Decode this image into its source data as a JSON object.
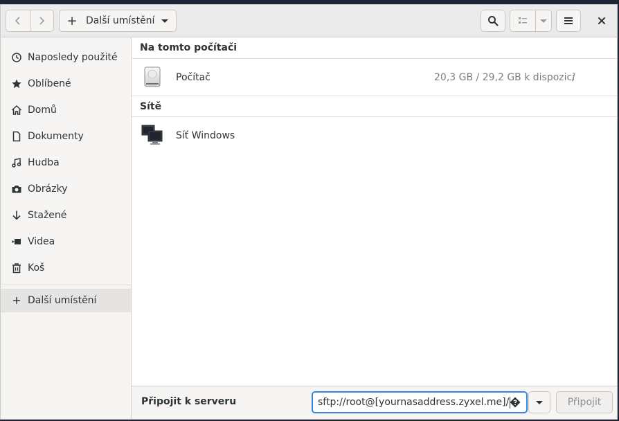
{
  "headerbar": {
    "path_button_label": "Další umístění"
  },
  "sidebar": {
    "items": [
      {
        "label": "Naposledy použité",
        "icon": "clock-icon"
      },
      {
        "label": "Oblíbené",
        "icon": "star-icon"
      },
      {
        "label": "Domů",
        "icon": "home-icon"
      },
      {
        "label": "Dokumenty",
        "icon": "document-icon"
      },
      {
        "label": "Hudba",
        "icon": "music-icon"
      },
      {
        "label": "Obrázky",
        "icon": "camera-icon"
      },
      {
        "label": "Stažené",
        "icon": "download-arrow-icon"
      },
      {
        "label": "Videa",
        "icon": "video-icon"
      },
      {
        "label": "Koš",
        "icon": "trash-icon"
      }
    ],
    "other_locations_label": "Další umístění"
  },
  "main": {
    "section_computer": "Na tomto počítači",
    "computer_row": {
      "name": "Počítač",
      "info": "20,3 GB / 29,2 GB k dispozici",
      "path": "/"
    },
    "section_networks": "Sítě",
    "network_row": {
      "name": "Síť Windows"
    }
  },
  "bottombar": {
    "label": "Připojit k serveru",
    "server_address": "sftp://root@[yournasaddress.zyxel.me]/",
    "connect_label": "Připojit"
  },
  "colors": {
    "accent": "#3584e4",
    "window_bg": "#ffffff",
    "sidebar_bg": "#f6f5f4"
  }
}
